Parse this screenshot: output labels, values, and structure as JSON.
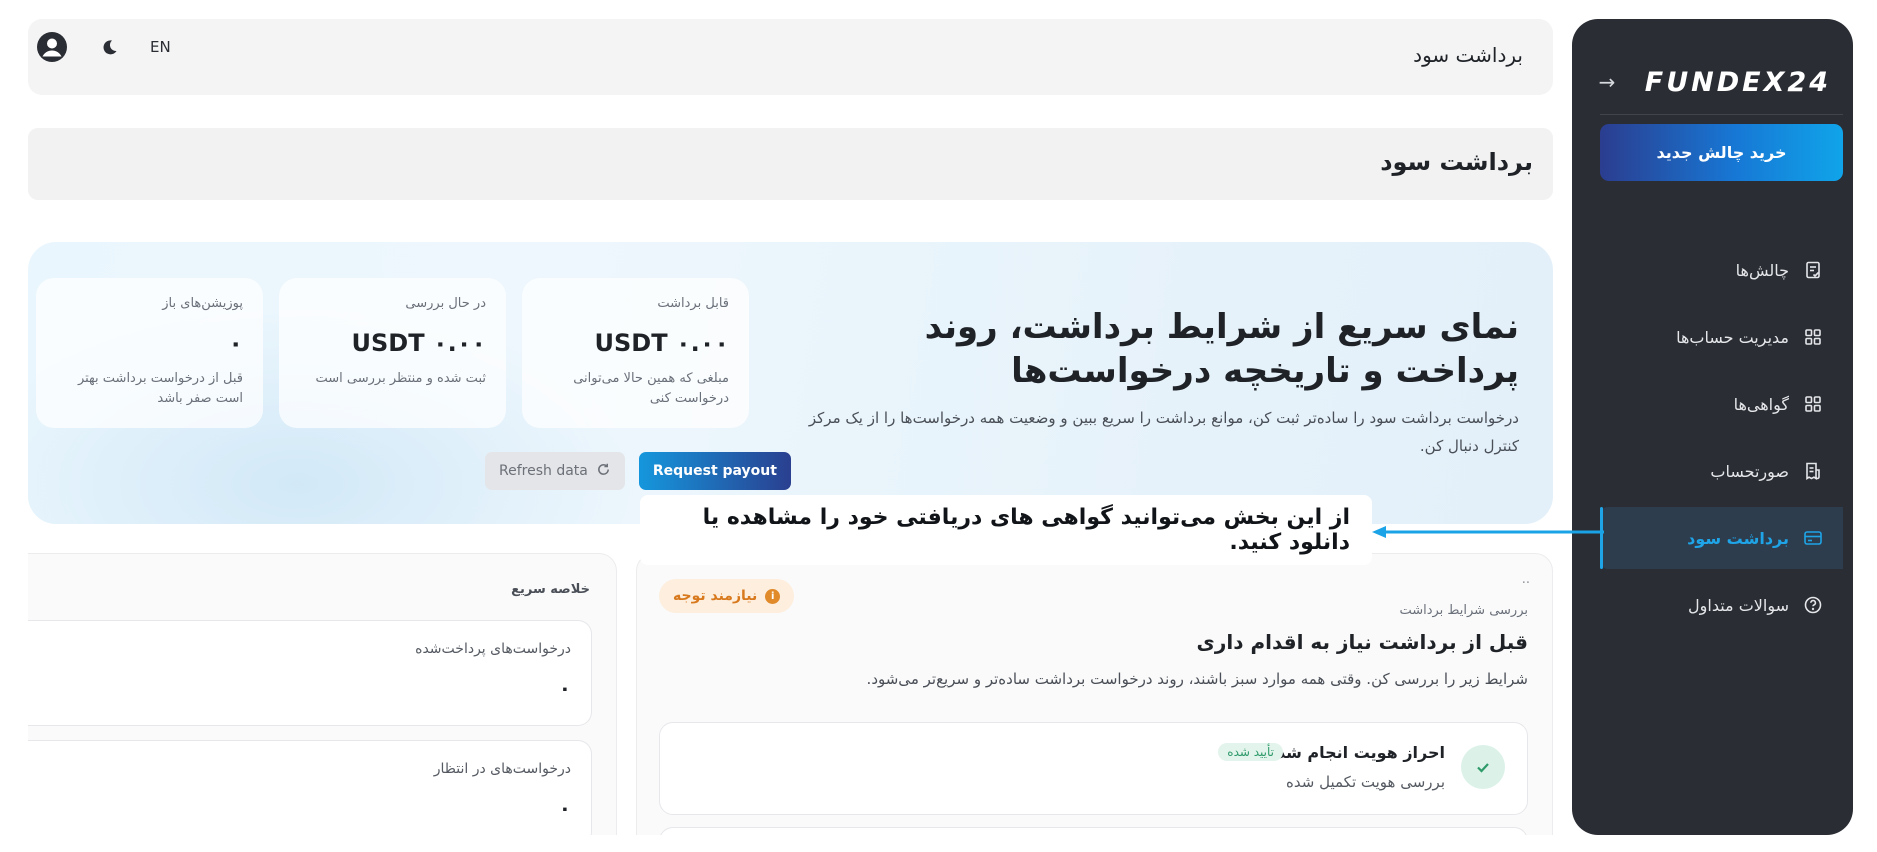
{
  "sidebar": {
    "logo": "FUNDEX24",
    "buy_button": "خرید چالش جدید",
    "items": [
      {
        "label": "چالش‌ها",
        "icon": "checklist-icon",
        "active": false
      },
      {
        "label": "مدیریت حساب‌ها",
        "icon": "grid-icon",
        "active": false
      },
      {
        "label": "گواهی‌ها",
        "icon": "grid-icon",
        "active": false
      },
      {
        "label": "صورتحساب",
        "icon": "invoice-icon",
        "active": false
      },
      {
        "label": "برداشت سود",
        "icon": "card-icon",
        "active": true
      },
      {
        "label": "سوالات متداول",
        "icon": "question-circle-icon",
        "active": false
      }
    ]
  },
  "header": {
    "title": "برداشت سود",
    "lang": "EN"
  },
  "page": {
    "title": "برداشت سود"
  },
  "hero": {
    "heading": "نمای سریع از شرایط برداشت، روند پرداخت و تاریخچه درخواست‌ها",
    "description": "درخواست برداشت سود را ساده‌تر ثبت کن، موانع برداشت را سریع ببین و وضعیت همه درخواست‌ها را از یک مرکز کنترل دنبال کن.",
    "stats": [
      {
        "label": "قابل برداشت",
        "value": "USDT ۰.۰۰",
        "note": "مبلغی که همین حالا می‌توانی درخواست کنی"
      },
      {
        "label": "در حال بررسی",
        "value": "USDT ۰.۰۰",
        "note": "ثبت شده و منتظر بررسی است"
      },
      {
        "label": "پوزیشن‌های باز",
        "value": "۰",
        "note": "قبل از درخواست برداشت بهتر است صفر باشد"
      }
    ],
    "request_payout": "Request payout",
    "refresh": "Refresh data"
  },
  "callout": {
    "text": "از این بخش می‌توانید گواهی های دریافتی خود را مشاهده یا دانلود کنید."
  },
  "conditions": {
    "dots": "..",
    "eyebrow": "بررسی شرایط برداشت",
    "title": "قبل از برداشت نیاز به اقدام داری",
    "description": "شرایط زیر را بررسی کن. وقتی همه موارد سبز باشند، روند درخواست برداشت ساده‌تر و سریع‌تر می‌شود.",
    "badge": "نیازمند توجه",
    "checks": [
      {
        "title": "احراز هویت انجام شده",
        "badge": "تأیید شده",
        "sub": "بررسی هویت تکمیل شده"
      }
    ]
  },
  "summary": {
    "title": "خلاصه سریع",
    "cards": [
      {
        "label": "درخواست‌های پرداخت‌شده",
        "value": "۰"
      },
      {
        "label": "درخواست‌های در انتظار",
        "value": "۰"
      }
    ]
  },
  "colors": {
    "sidebar_bg": "#2a2d33",
    "accent": "#1ea4e7",
    "brand_dark": "#2a3f8f",
    "warning": "#d8791d",
    "success": "#2f9a6a"
  }
}
